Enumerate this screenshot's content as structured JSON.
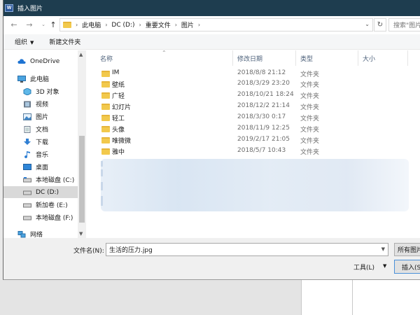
{
  "window": {
    "title": "插入图片",
    "app_icon_letter": "W"
  },
  "address_bar": {
    "crumbs": [
      "此电脑",
      "DC (D:)",
      "重要文件",
      "图片"
    ],
    "search_placeholder": "搜索\"图片"
  },
  "toolbar": {
    "organize_label": "组织",
    "new_folder_label": "新建文件夹"
  },
  "nav_pane": {
    "items": [
      {
        "label": "OneDrive",
        "icon": "cloud-icon"
      },
      {
        "label": "此电脑",
        "icon": "computer-icon"
      },
      {
        "label": "3D 对象",
        "icon": "cube-icon"
      },
      {
        "label": "视频",
        "icon": "video-icon"
      },
      {
        "label": "图片",
        "icon": "pictures-icon"
      },
      {
        "label": "文档",
        "icon": "document-icon"
      },
      {
        "label": "下载",
        "icon": "download-icon"
      },
      {
        "label": "音乐",
        "icon": "music-icon"
      },
      {
        "label": "桌面",
        "icon": "desktop-icon"
      },
      {
        "label": "本地磁盘 (C:)",
        "icon": "drive-icon"
      },
      {
        "label": "DC (D:)",
        "icon": "drive-icon"
      },
      {
        "label": "新加卷 (E:)",
        "icon": "drive-icon"
      },
      {
        "label": "本地磁盘 (F:)",
        "icon": "drive-icon"
      },
      {
        "label": "网络",
        "icon": "network-icon"
      }
    ]
  },
  "file_list": {
    "headers": {
      "name": "名称",
      "date": "修改日期",
      "type": "类型",
      "size": "大小"
    },
    "rows": [
      {
        "name": "IM",
        "date": "2018/8/8 21:12",
        "type": "文件夹"
      },
      {
        "name": "壁纸",
        "date": "2018/3/29 23:20",
        "type": "文件夹"
      },
      {
        "name": "广轻",
        "date": "2018/10/21 18:24",
        "type": "文件夹"
      },
      {
        "name": "幻灯片",
        "date": "2018/12/2 21:14",
        "type": "文件夹"
      },
      {
        "name": "轻工",
        "date": "2018/3/30 0:17",
        "type": "文件夹"
      },
      {
        "name": "头像",
        "date": "2018/11/9 12:25",
        "type": "文件夹"
      },
      {
        "name": "唯微微",
        "date": "2019/2/17 21:05",
        "type": "文件夹"
      },
      {
        "name": "雅中",
        "date": "2018/5/7 10:43",
        "type": "文件夹"
      }
    ]
  },
  "bottom": {
    "filename_label": "文件名(N):",
    "filename_value": "生活的压力.jpg",
    "file_type_label": "所有图片",
    "tools_label": "工具(L)",
    "insert_label": "插入(S)"
  },
  "colors": {
    "titlebar": "#1e3d4f",
    "folder": "#f2c94c",
    "selected": "#d9d9d9",
    "header_text": "#4c607a"
  }
}
